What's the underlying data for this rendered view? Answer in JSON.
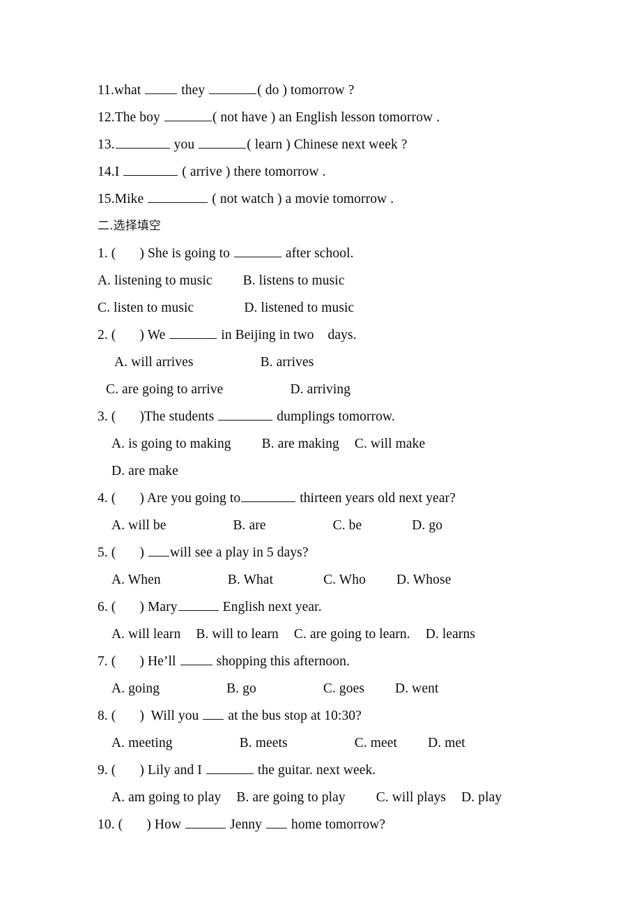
{
  "document": {
    "type": "english-grammar-worksheet",
    "language_mix": [
      "en",
      "zh-CN"
    ]
  },
  "fill_in_blanks": {
    "items": [
      {
        "number": "11.",
        "pre": "what",
        "mid": "they",
        "hint": "( do )",
        "post": "tomorrow ?",
        "full_text": "11.what _____ they _______( do ) tomorrow ?"
      },
      {
        "number": "12.",
        "pre": "The boy",
        "hint": "( not have )",
        "post": "an English lesson tomorrow .",
        "full_text": "12.The boy _______( not have ) an English lesson tomorrow ."
      },
      {
        "number": "13.",
        "mid": "you",
        "hint": "( learn )",
        "post": "Chinese next week ?",
        "full_text": "13.________ you _______( learn ) Chinese next week ?"
      },
      {
        "number": "14.",
        "pre": "I",
        "hint": "( arrive )",
        "post": "there tomorrow .",
        "full_text": "14.I ________ ( arrive ) there tomorrow ."
      },
      {
        "number": "15.",
        "pre": "Mike",
        "hint": "( not watch )",
        "post": "a movie tomorrow .",
        "full_text": "15.Mike _________ ( not watch ) a movie tomorrow ."
      }
    ]
  },
  "section_two": {
    "heading": "二.选择填空",
    "questions": [
      {
        "number": "1. (",
        "close_paren": ")",
        "stem_pre": "She is going to",
        "stem_post": "after school.",
        "options_rows": [
          [
            {
              "label": "A. listening to music"
            },
            {
              "label": "B. listens to music"
            }
          ],
          [
            {
              "label": "C. listen to music"
            },
            {
              "label": "D. listened to music"
            }
          ]
        ]
      },
      {
        "number": "2. (",
        "close_paren": ")",
        "stem_pre": "We",
        "stem_post": "in Beijing in two    days.",
        "options_rows": [
          [
            {
              "label": "A. will arrives"
            },
            {
              "label": "B. arrives"
            }
          ],
          [
            {
              "label": "C. are going to arrive"
            },
            {
              "label": "D. arriving"
            }
          ]
        ]
      },
      {
        "number": "3. (",
        "close_paren": ")",
        "stem_pre": "The students",
        "stem_post": "dumplings tomorrow.",
        "options_rows": [
          [
            {
              "label": "A. is going to making"
            },
            {
              "label": "B. are making"
            },
            {
              "label": "C. will make"
            }
          ],
          [
            {
              "label": "D. are make"
            }
          ]
        ]
      },
      {
        "number": "4. (",
        "close_paren": ")",
        "stem_pre": "Are you going to",
        "stem_post": "thirteen years old next year?",
        "options_rows": [
          [
            {
              "label": "A. will be"
            },
            {
              "label": "B. are"
            },
            {
              "label": "C. be"
            },
            {
              "label": "D. go"
            }
          ]
        ]
      },
      {
        "number": "5. (",
        "close_paren": ")",
        "stem_pre": "",
        "stem_post": "will see a play in 5 days?",
        "options_rows": [
          [
            {
              "label": "A. When"
            },
            {
              "label": "B. What"
            },
            {
              "label": "C. Who"
            },
            {
              "label": "D. Whose"
            }
          ]
        ]
      },
      {
        "number": "6. (",
        "close_paren": ")",
        "stem_pre": "Mary",
        "stem_post": "English next year.",
        "options_rows": [
          [
            {
              "label": "A. will learn"
            },
            {
              "label": "B. will to learn"
            },
            {
              "label": "C. are going to learn."
            },
            {
              "label": "D. learns"
            }
          ]
        ]
      },
      {
        "number": "7. (",
        "close_paren": ")",
        "stem_pre": "He’ll",
        "stem_post": "shopping this afternoon.",
        "options_rows": [
          [
            {
              "label": "A. going"
            },
            {
              "label": "B. go"
            },
            {
              "label": "C. goes"
            },
            {
              "label": "D. went"
            }
          ]
        ]
      },
      {
        "number": "8. (",
        "close_paren": ")",
        "stem_pre": "Will you",
        "stem_post": "at the bus stop at 10:30?",
        "options_rows": [
          [
            {
              "label": "A. meeting"
            },
            {
              "label": "B. meets"
            },
            {
              "label": "C. meet"
            },
            {
              "label": "D. met"
            }
          ]
        ]
      },
      {
        "number": "9. (",
        "close_paren": ")",
        "stem_pre": "Lily and I",
        "stem_post": "the guitar. next week.",
        "options_rows": [
          [
            {
              "label": "A. am going to play"
            },
            {
              "label": "B. are going to play"
            },
            {
              "label": "C. will plays"
            },
            {
              "label": "D. play"
            }
          ]
        ]
      },
      {
        "number": "10. (",
        "close_paren": ")",
        "stem_pre": "How",
        "stem_mid": "Jenny",
        "stem_post": "home tomorrow?",
        "options_rows": []
      }
    ]
  }
}
